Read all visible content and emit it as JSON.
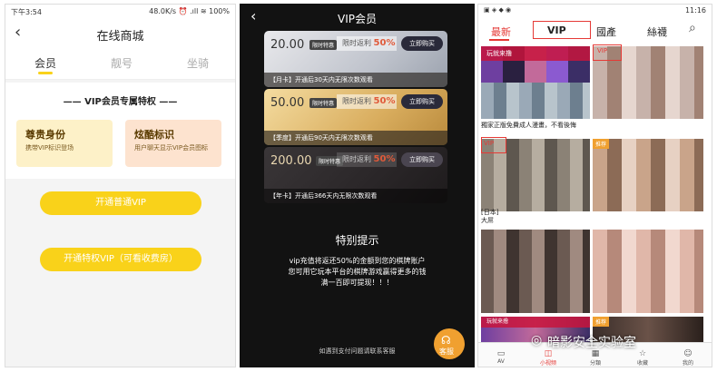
{
  "panel1": {
    "status": {
      "time": "下午3:54",
      "network": "48.0K/s ⏰ .ıll ≋ 100%"
    },
    "title": "在线商城",
    "tabs": [
      "会员",
      "靓号",
      "坐骑"
    ],
    "section_title": "—— VIP会员专属特权 ——",
    "perks": [
      {
        "title": "尊贵身份",
        "desc": "携带VIP标识登场"
      },
      {
        "title": "炫酷标识",
        "desc": "用户聊天显示VIP会员图标"
      }
    ],
    "buttons": {
      "normal_vip": "开通普通VIP",
      "special_vip": "开通特权VIP（可看收费房）"
    },
    "colors": {
      "accent": "#f9d21a",
      "tab_active": "#333333"
    }
  },
  "panel2": {
    "title": "VIP会员",
    "cards": [
      {
        "price": "20.00",
        "tag": "限时特惠",
        "return_label": "限时返利",
        "return_pct": "50%",
        "buy": "立即购买",
        "desc": "【月卡】开通后30天内无限次数观看"
      },
      {
        "price": "50.00",
        "tag": "限时特惠",
        "return_label": "限时返利",
        "return_pct": "50%",
        "buy": "立即购买",
        "desc": "【季度】开通后90天内无限次数观看"
      },
      {
        "price": "200.00",
        "tag": "限时特惠",
        "return_label": "限时返利",
        "return_pct": "50%",
        "buy": "立即购买",
        "desc": "【年卡】开通后366天内无限次数观看"
      }
    ],
    "notice_title": "特别提示",
    "notice_lines": [
      "vip充值将返还50%的金额到您的棋牌账户",
      "您可用它玩本平台的棋牌游戏赢得更多的钱",
      "满一百即可提现！！！"
    ],
    "footer": "如遇到支付问题请联系客服",
    "service_label": "客服"
  },
  "panel3": {
    "status": {
      "speed": "0B/s\n27 kB/s",
      "time": "11:16"
    },
    "tabs": [
      "最新",
      "VIP",
      "國產",
      "絲襪"
    ],
    "active_tab": "最新",
    "badges": {
      "vip": "VIP",
      "recommend": "推荐",
      "game": "玩就来撸"
    },
    "captions": [
      "獨家正版免費成人漫畫，不看後悔",
      "[日本]",
      "大屌"
    ],
    "nav": [
      "AV",
      "小视频",
      "分類",
      "收藏",
      "我的"
    ],
    "watermark": "暗影安全实验室",
    "colors": {
      "accent": "#e53935"
    }
  }
}
